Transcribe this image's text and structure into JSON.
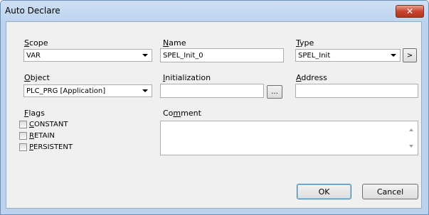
{
  "window": {
    "title": "Auto Declare",
    "close_glyph": "✕"
  },
  "scope": {
    "label_u": "S",
    "label_rest": "cope",
    "value": "VAR"
  },
  "name": {
    "label_u": "N",
    "label_rest": "ame",
    "value": "SPEL_Init_0"
  },
  "type": {
    "label_u": "T",
    "label_rest": "ype",
    "value": "SPEL_Init",
    "more_button": ">"
  },
  "object": {
    "label_u": "O",
    "label_rest": "bject",
    "value": "PLC_PRG [Application]"
  },
  "initialization": {
    "label_u": "I",
    "label_rest": "nitialization",
    "value": "",
    "browse_button": "..."
  },
  "address": {
    "label_u": "A",
    "label_rest": "ddress",
    "value": ""
  },
  "flags": {
    "label_u": "F",
    "label_rest": "lags",
    "items": [
      {
        "u": "C",
        "rest": "ONSTANT",
        "checked": false
      },
      {
        "u": "R",
        "rest": "ETAIN",
        "checked": false
      },
      {
        "u": "P",
        "rest": "ERSISTENT",
        "checked": false
      }
    ]
  },
  "comment": {
    "label_pre": "Co",
    "label_u": "m",
    "label_rest": "ment",
    "value": ""
  },
  "buttons": {
    "ok": "OK",
    "cancel": "Cancel"
  }
}
